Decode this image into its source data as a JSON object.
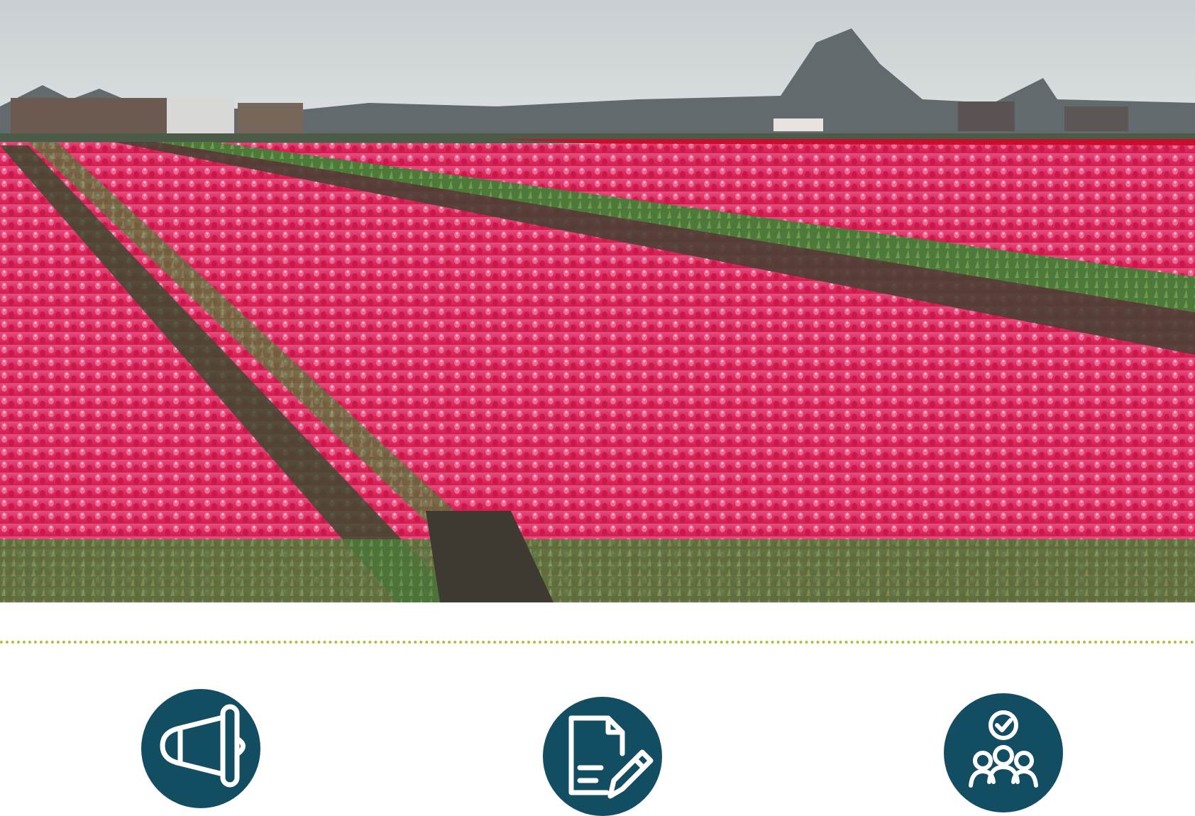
{
  "hero": {
    "subject": "tulip-field-photo",
    "colors": {
      "sky": "#d3d8da",
      "treeline": "#5b6266",
      "tulip_pink": "#e0336c",
      "tulip_red": "#c8102e",
      "foliage": "#4f7a3a",
      "soil": "#4a4034"
    }
  },
  "divider": {
    "color": "#a8c43a",
    "style": "dotted"
  },
  "icons": [
    {
      "name": "megaphone-icon",
      "bg": "#124d62"
    },
    {
      "name": "document-edit-icon",
      "bg": "#124d62"
    },
    {
      "name": "team-approval-icon",
      "bg": "#124d62"
    }
  ]
}
